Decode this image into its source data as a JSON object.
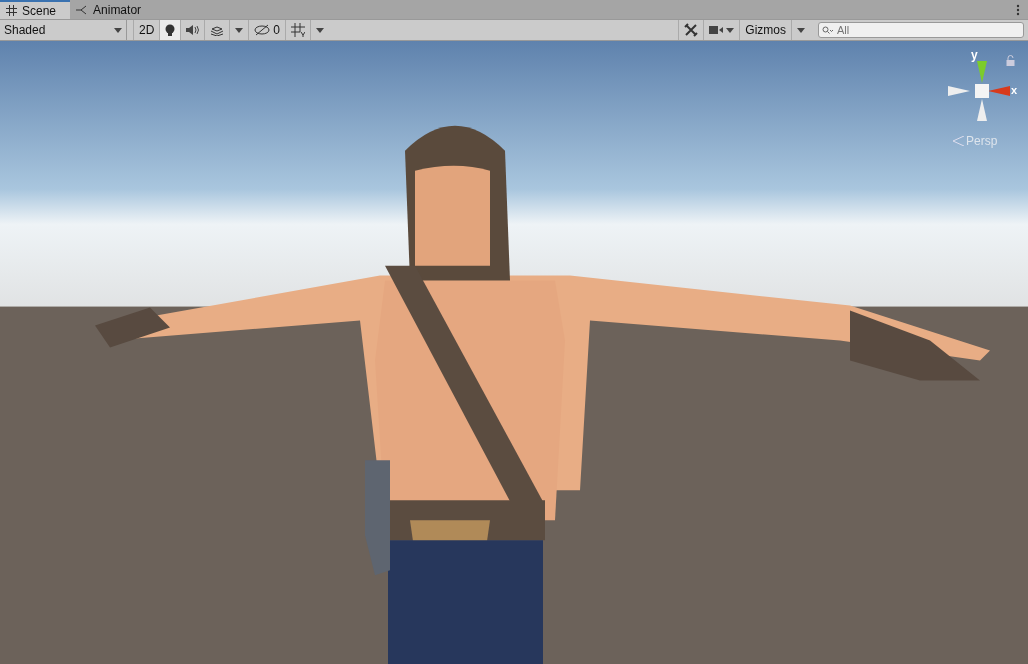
{
  "tabs": [
    {
      "label": "Scene",
      "kind": "scene",
      "selected": true
    },
    {
      "label": "Animator",
      "kind": "animator",
      "selected": false
    }
  ],
  "toolbar": {
    "draw_mode": "Shaded",
    "toggles": [
      {
        "kind": "dimension",
        "label": "2D",
        "selected": false
      },
      {
        "kind": "lighting",
        "selected": true
      },
      {
        "kind": "audio",
        "selected": false
      },
      {
        "kind": "effects",
        "selected": false
      },
      {
        "kind": "hidden",
        "label": "0",
        "selected": false
      },
      {
        "kind": "grid",
        "selected": false
      }
    ],
    "gizmos_label": "Gizmos",
    "search": {
      "placeholder": "All"
    }
  },
  "gizmo": {
    "y_label": "y",
    "x_label": "x",
    "projection": "Persp"
  }
}
